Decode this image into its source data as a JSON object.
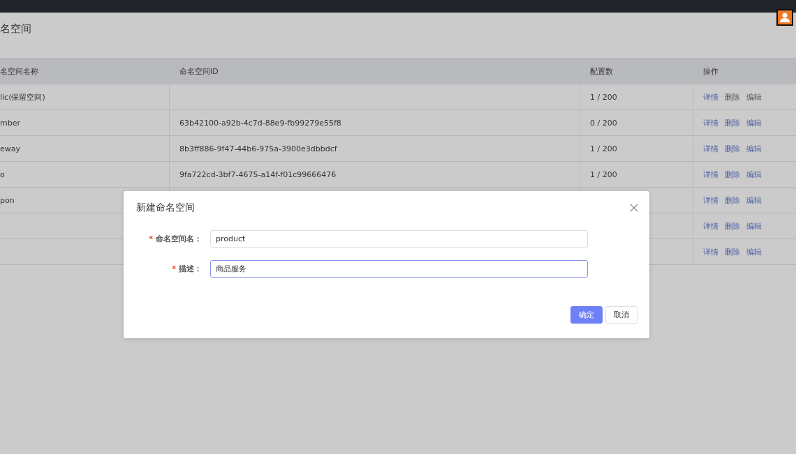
{
  "page": {
    "title": "名空间"
  },
  "table": {
    "columns": [
      "名空间名称",
      "命名空间ID",
      "配置数",
      "操作"
    ],
    "rows": [
      {
        "cells": [
          "lic(保留空间)",
          "",
          "1 / 200"
        ],
        "actions": [
          {
            "label": "详情",
            "disabled": false
          },
          {
            "label": "删除",
            "disabled": true
          },
          {
            "label": "编辑",
            "disabled": true
          }
        ]
      },
      {
        "cells": [
          "mber",
          "63b42100-a92b-4c7d-88e9-fb99279e55f8",
          "0 / 200"
        ],
        "actions": [
          {
            "label": "详情",
            "disabled": false
          },
          {
            "label": "删除",
            "disabled": false
          },
          {
            "label": "编辑",
            "disabled": false
          }
        ]
      },
      {
        "cells": [
          "eway",
          "8b3ff886-9f47-44b6-975a-3900e3dbbdcf",
          "1 / 200"
        ],
        "actions": [
          {
            "label": "详情",
            "disabled": false
          },
          {
            "label": "删除",
            "disabled": false
          },
          {
            "label": "编辑",
            "disabled": false
          }
        ]
      },
      {
        "cells": [
          "o",
          "9fa722cd-3bf7-4675-a14f-f01c99666476",
          "1 / 200"
        ],
        "actions": [
          {
            "label": "详情",
            "disabled": false
          },
          {
            "label": "删除",
            "disabled": false
          },
          {
            "label": "编辑",
            "disabled": false
          }
        ]
      },
      {
        "cells": [
          "pon",
          "",
          ""
        ],
        "actions": [
          {
            "label": "详情",
            "disabled": false
          },
          {
            "label": "删除",
            "disabled": false
          },
          {
            "label": "编辑",
            "disabled": false
          }
        ]
      },
      {
        "cells": [
          "",
          "",
          ""
        ],
        "actions": [
          {
            "label": "详情",
            "disabled": false
          },
          {
            "label": "删除",
            "disabled": false
          },
          {
            "label": "编辑",
            "disabled": false
          }
        ]
      },
      {
        "cells": [
          "",
          "",
          ""
        ],
        "actions": [
          {
            "label": "详情",
            "disabled": false
          },
          {
            "label": "删除",
            "disabled": false
          },
          {
            "label": "编辑",
            "disabled": false
          }
        ]
      }
    ]
  },
  "dialog": {
    "title": "新建命名空间",
    "fields": [
      {
        "label": "命名空间名：",
        "required_mark": "*",
        "value": "product",
        "focused": false
      },
      {
        "label": "描述：",
        "required_mark": "*",
        "value": "商品服务",
        "focused": true
      }
    ],
    "buttons": [
      {
        "label": "确定",
        "kind": "primary"
      },
      {
        "label": "取消",
        "kind": "default"
      }
    ]
  }
}
